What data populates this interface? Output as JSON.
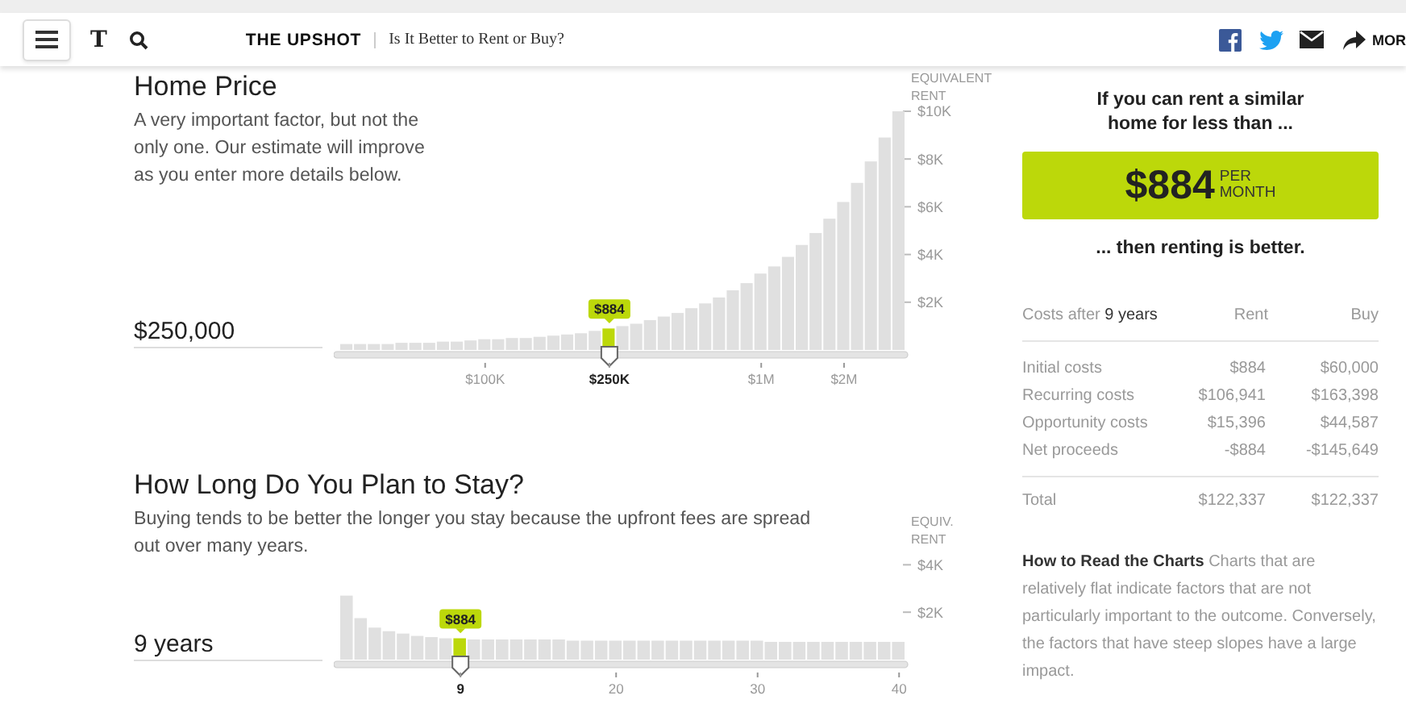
{
  "topbar": {
    "logo": "T",
    "section": "THE UPSHOT",
    "article_title": "Is It Better to Rent or Buy?",
    "share_more": "MOR"
  },
  "factors": [
    {
      "title": "Home Price",
      "description": "A very important factor, but not the only one. Our estimate will improve as you enter more details below.",
      "value": "$250,000",
      "chart_data": {
        "type": "bar",
        "ylabel": "EQUIVALENT RENT",
        "categories": [
          null,
          null,
          null,
          null,
          null,
          null,
          null,
          null,
          null,
          null,
          "$100K",
          null,
          null,
          null,
          null,
          null,
          null,
          null,
          null,
          "$250K",
          null,
          null,
          null,
          null,
          null,
          null,
          null,
          null,
          null,
          null,
          "$1M",
          null,
          null,
          null,
          null,
          null,
          "$2M",
          null,
          null,
          null,
          null
        ],
        "ylim": [
          0,
          10000
        ],
        "values": [
          250,
          250,
          250,
          250,
          300,
          300,
          300,
          350,
          350,
          400,
          450,
          450,
          500,
          500,
          550,
          600,
          650,
          700,
          800,
          900,
          1000,
          1100,
          1250,
          1400,
          1550,
          1750,
          1950,
          2200,
          2500,
          2800,
          3200,
          3500,
          3900,
          4400,
          4900,
          5500,
          6200,
          7000,
          7900,
          8900,
          10000
        ],
        "yticks": [
          {
            "value": 2000,
            "label": "$2K"
          },
          {
            "value": 4000,
            "label": "$4K"
          },
          {
            "value": 6000,
            "label": "$6K"
          },
          {
            "value": 8000,
            "label": "$8K"
          },
          {
            "value": 10000,
            "label": "$10K"
          }
        ],
        "annotations": [
          {
            "x": "$250K",
            "y": 900,
            "text": "$884"
          }
        ]
      }
    },
    {
      "title": "How Long Do You Plan to Stay?",
      "description": "Buying tends to be better the longer you stay because the upfront fees are spread out over many years.",
      "value": "9 years",
      "chart_data": {
        "type": "bar",
        "ylabel": "EQUIV. RENT",
        "categories": [
          null,
          null,
          null,
          null,
          null,
          null,
          null,
          null,
          "9",
          null,
          null,
          null,
          null,
          null,
          null,
          null,
          null,
          null,
          null,
          "20",
          null,
          null,
          null,
          null,
          null,
          null,
          null,
          null,
          null,
          "30",
          null,
          null,
          null,
          null,
          null,
          null,
          null,
          null,
          null,
          "40"
        ],
        "ylim": [
          0,
          4000
        ],
        "values": [
          2700,
          1750,
          1350,
          1200,
          1100,
          1000,
          950,
          900,
          900,
          850,
          850,
          850,
          850,
          850,
          850,
          850,
          800,
          800,
          800,
          800,
          800,
          800,
          800,
          800,
          800,
          800,
          800,
          800,
          800,
          800,
          750,
          750,
          750,
          750,
          750,
          750,
          750,
          750,
          750,
          750
        ],
        "yticks": [
          {
            "value": 2000,
            "label": "$2K"
          },
          {
            "value": 4000,
            "label": "$4K"
          }
        ],
        "annotations": [
          {
            "x": "9",
            "y": 900,
            "text": "$884"
          }
        ]
      }
    }
  ],
  "result": {
    "intro": "If you can rent a similar home for less than ...",
    "amount": "$884",
    "unit_top": "PER",
    "unit_bottom": "MONTH",
    "conclusion": "... then renting is better."
  },
  "costs": {
    "heading_prefix": "Costs after",
    "heading_years": "9 years",
    "columns": [
      "Rent",
      "Buy"
    ],
    "rows": [
      {
        "label": "Initial costs",
        "rent": "$884",
        "buy": "$60,000"
      },
      {
        "label": "Recurring costs",
        "rent": "$106,941",
        "buy": "$163,398"
      },
      {
        "label": "Opportunity costs",
        "rent": "$15,396",
        "buy": "$44,587"
      },
      {
        "label": "Net proceeds",
        "rent": "-$884",
        "buy": "-$145,649"
      }
    ],
    "total": {
      "label": "Total",
      "rent": "$122,337",
      "buy": "$122,337"
    }
  },
  "note": "**How to Read the Charts** Charts that are relatively flat indicate factors that are not particularly important to the outcome. Conversely, the factors that have steep slopes have a large impact."
}
